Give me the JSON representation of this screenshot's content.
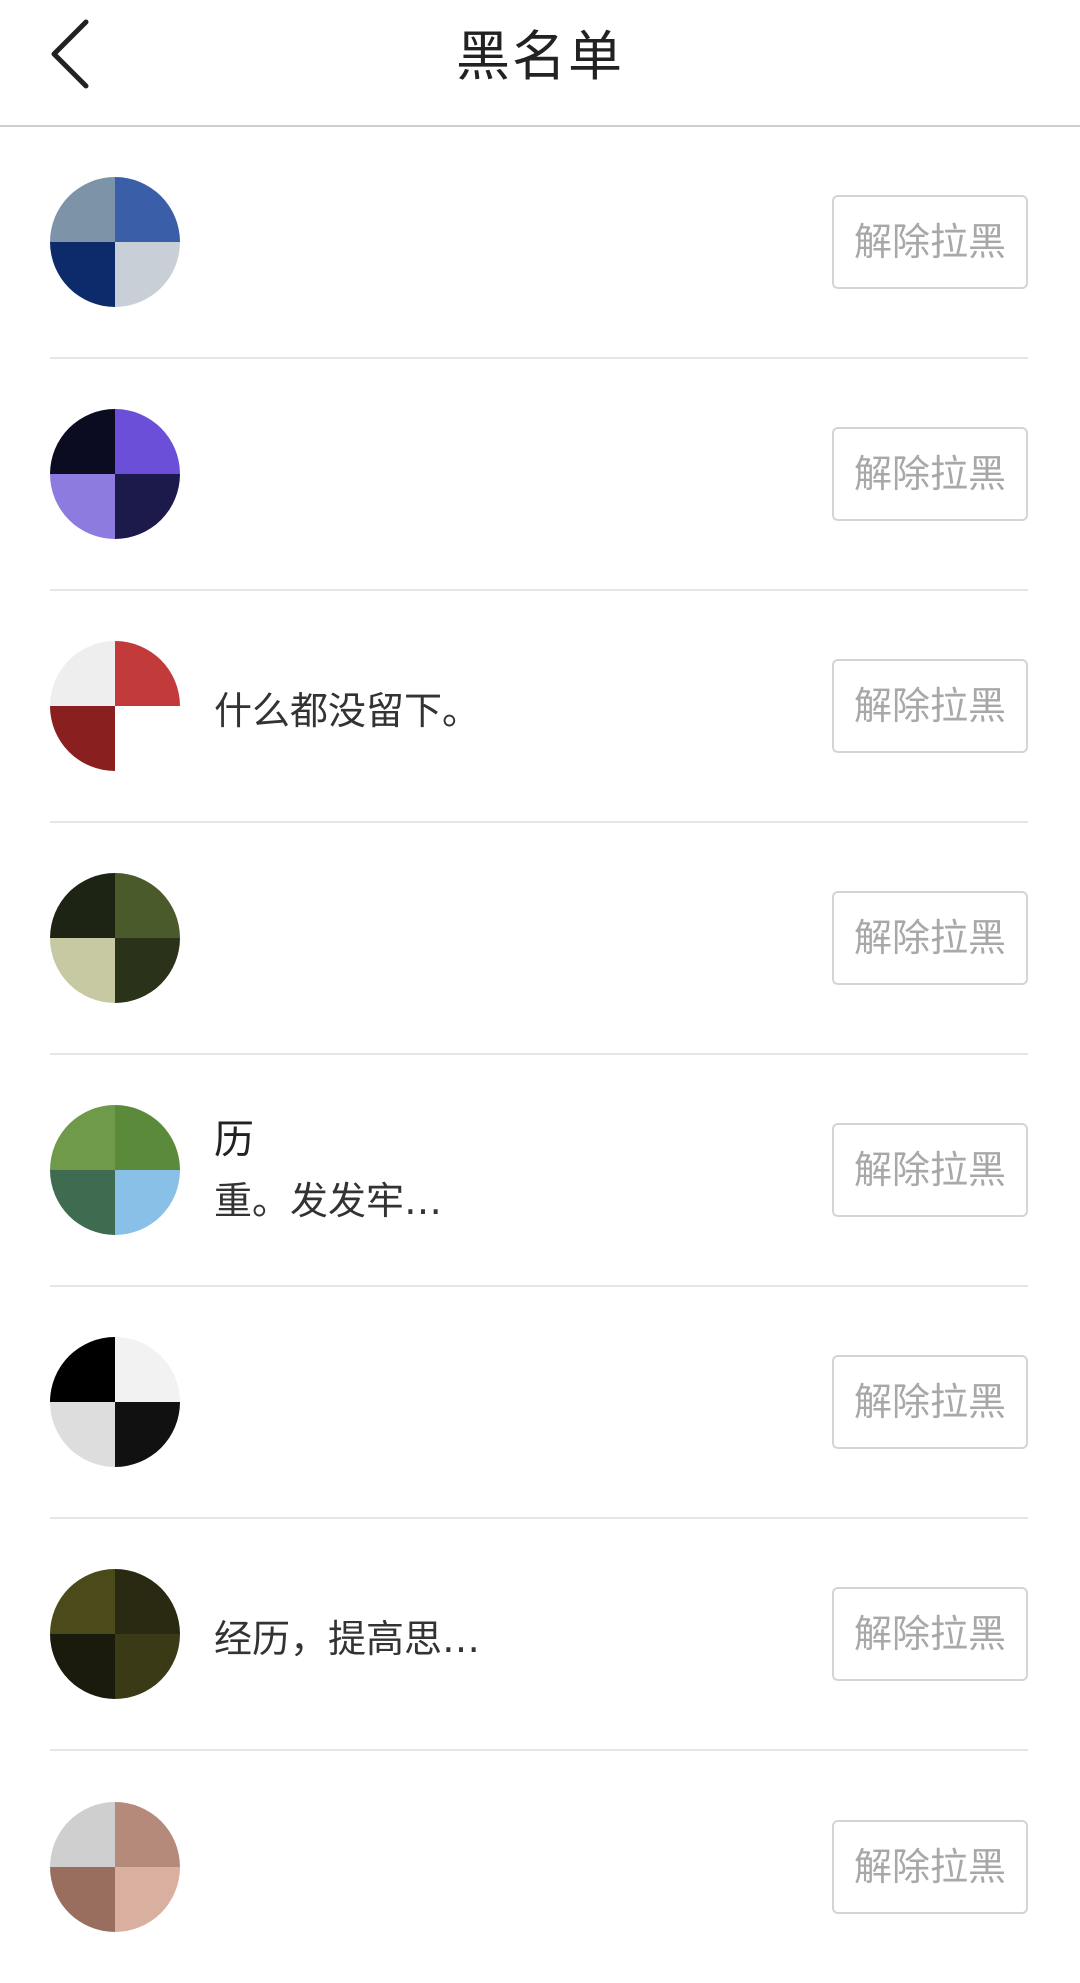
{
  "header": {
    "title": "黑名单",
    "back_icon": "chevron-left-icon"
  },
  "blocked_users": [
    {
      "name": "",
      "signature": "",
      "button_label": "解除拉黑",
      "avatar_colors": [
        "#3a5ea8",
        "#c9cfd6",
        "#0d2a6b",
        "#7d93a8"
      ]
    },
    {
      "name": "",
      "signature": "",
      "button_label": "解除拉黑",
      "avatar_colors": [
        "#6b4fd8",
        "#1c1a4a",
        "#8e7be0",
        "#0b0b22"
      ]
    },
    {
      "name": "",
      "signature": "什么都没留下。",
      "button_label": "解除拉黑",
      "avatar_colors": [
        "#c23a3a",
        "#ffffff",
        "#8a1f1f",
        "#eeeeee"
      ]
    },
    {
      "name": "",
      "signature": "",
      "button_label": "解除拉黑",
      "avatar_colors": [
        "#4b5a2a",
        "#2a321a",
        "#c7c9a3",
        "#1e2414"
      ]
    },
    {
      "name": "历",
      "signature": "重。发发牢…",
      "button_label": "解除拉黑",
      "avatar_colors": [
        "#5b8a3a",
        "#88c0e8",
        "#3f6b50",
        "#6f9a4a"
      ]
    },
    {
      "name": "",
      "signature": "",
      "button_label": "解除拉黑",
      "avatar_colors": [
        "#f2f2f2",
        "#111111",
        "#dddddd",
        "#000000"
      ]
    },
    {
      "name": "",
      "signature": "经历，提高思…",
      "button_label": "解除拉黑",
      "avatar_colors": [
        "#2a2a12",
        "#3a3a16",
        "#1b1b0d",
        "#4a4a1a"
      ]
    },
    {
      "name": "",
      "signature": "",
      "button_label": "解除拉黑",
      "avatar_colors": [
        "#b58a7a",
        "#d9b0a0",
        "#9a6e5e",
        "#cfcfcf"
      ]
    }
  ]
}
